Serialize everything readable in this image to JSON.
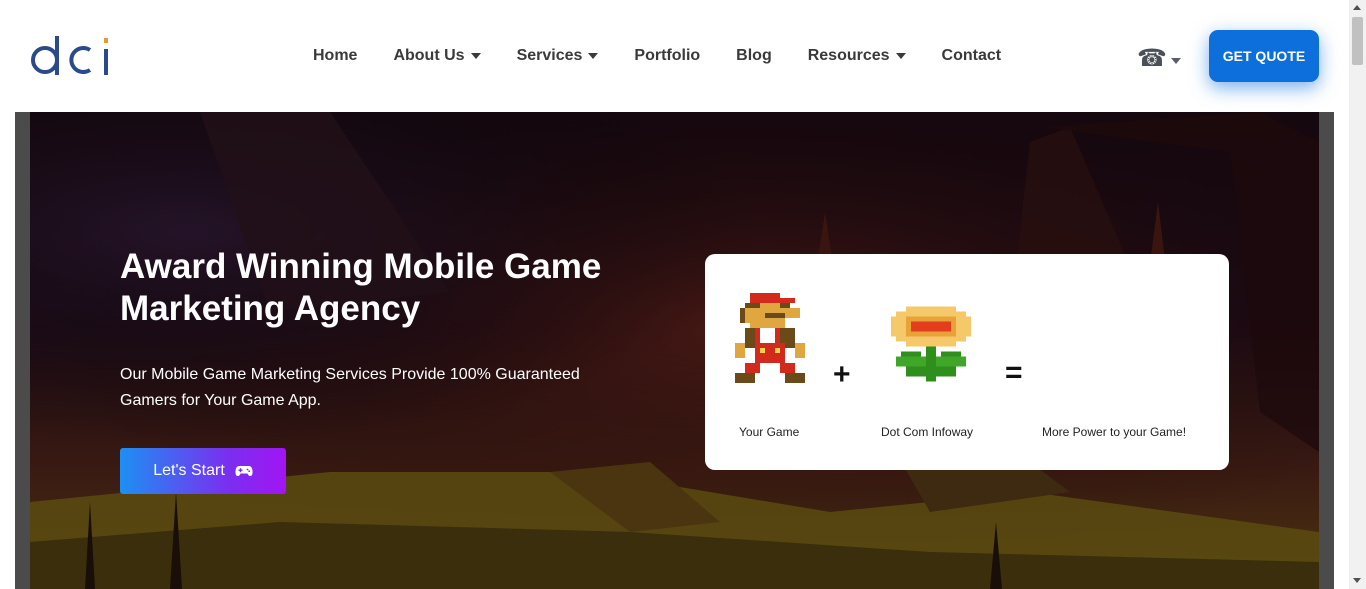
{
  "brand": {
    "logo_text": "dci"
  },
  "nav": {
    "items": [
      {
        "label": "Home",
        "dropdown": false
      },
      {
        "label": "About Us",
        "dropdown": true
      },
      {
        "label": "Services",
        "dropdown": true
      },
      {
        "label": "Portfolio",
        "dropdown": false
      },
      {
        "label": "Blog",
        "dropdown": false
      },
      {
        "label": "Resources",
        "dropdown": true
      },
      {
        "label": "Contact",
        "dropdown": false
      }
    ],
    "phone_icon": "☎",
    "quote_label": "GET QUOTE"
  },
  "hero": {
    "title": "Award Winning Mobile Game Marketing Agency",
    "subtitle": "Our Mobile Game Marketing Services Provide 100% Guaranteed Gamers for Your Game App.",
    "cta_label": "Let's Start"
  },
  "equation": {
    "plus": "+",
    "equals": "=",
    "left_caption": "Your Game",
    "middle_caption": "Dot Com Infoway",
    "right_caption": "More Power to your Game!"
  },
  "colors": {
    "logo_blue": "#2b4a8b",
    "logo_accent": "#e79b2c",
    "primary_button": "#0d6fdc",
    "cta_gradient_start": "#1d8ff2",
    "cta_gradient_end": "#a215f2"
  }
}
